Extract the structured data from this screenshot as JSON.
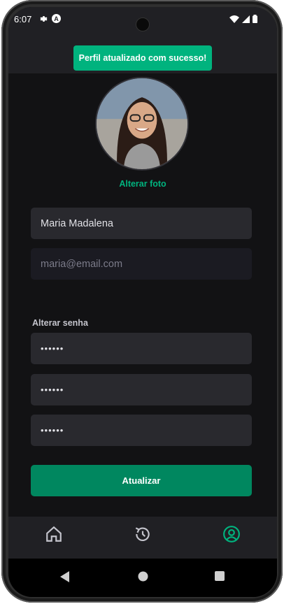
{
  "status_bar": {
    "time": "6:07",
    "a_badge": "A"
  },
  "toast": {
    "message": "Perfil atualizado com sucesso!"
  },
  "profile": {
    "change_photo_label": "Alterar foto"
  },
  "form": {
    "name_value": "Maria Madalena",
    "email_value": "maria@email.com",
    "password_section_label": "Alterar senha",
    "old_password_mask": "••••••",
    "new_password_mask": "••••••",
    "confirm_password_mask": "••••••",
    "submit_label": "Atualizar"
  },
  "tabbar": {
    "items": [
      {
        "icon": "home-icon",
        "active": false
      },
      {
        "icon": "history-icon",
        "active": false
      },
      {
        "icon": "user-icon",
        "active": true
      }
    ]
  },
  "colors": {
    "accent": "#00b37e",
    "button": "#00875f",
    "background": "#121214",
    "surface": "#29292e"
  }
}
